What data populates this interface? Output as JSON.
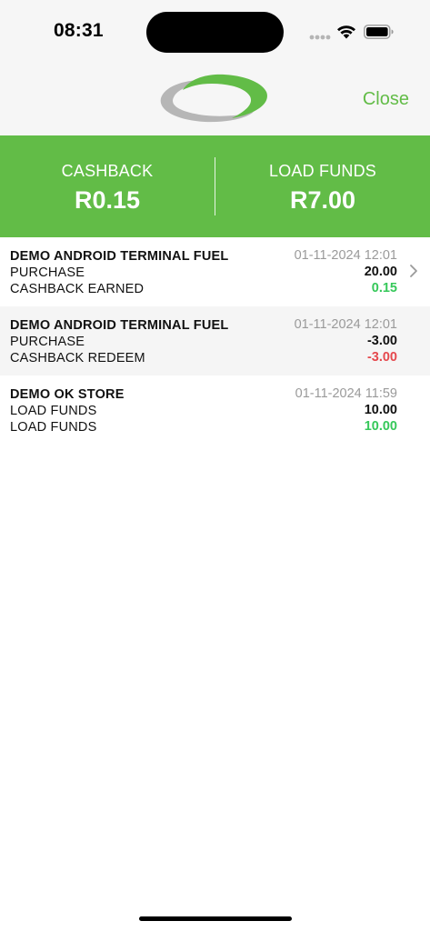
{
  "status_bar": {
    "time": "08:31"
  },
  "header": {
    "close_label": "Close"
  },
  "summary": {
    "cashback_label": "CASHBACK",
    "cashback_value": "R0.15",
    "load_label": "LOAD FUNDS",
    "load_value": "R7.00"
  },
  "colors": {
    "brand_green": "#62bc47",
    "positive": "#36c85a",
    "negative": "#e5484d"
  },
  "transactions": [
    {
      "merchant": "DEMO ANDROID TERMINAL FUEL",
      "datetime": "01-11-2024 12:01",
      "line1_type": "PURCHASE",
      "line1_amount": "20.00",
      "line2_type": "CASHBACK EARNED",
      "line2_amount": "0.15"
    },
    {
      "merchant": "DEMO ANDROID TERMINAL FUEL",
      "datetime": "01-11-2024 12:01",
      "line1_type": "PURCHASE",
      "line1_amount": "-3.00",
      "line2_type": "CASHBACK REDEEM",
      "line2_amount": "-3.00"
    },
    {
      "merchant": "DEMO OK STORE",
      "datetime": "01-11-2024 11:59",
      "line1_type": "LOAD FUNDS",
      "line1_amount": "10.00",
      "line2_type": "LOAD FUNDS",
      "line2_amount": "10.00"
    }
  ]
}
